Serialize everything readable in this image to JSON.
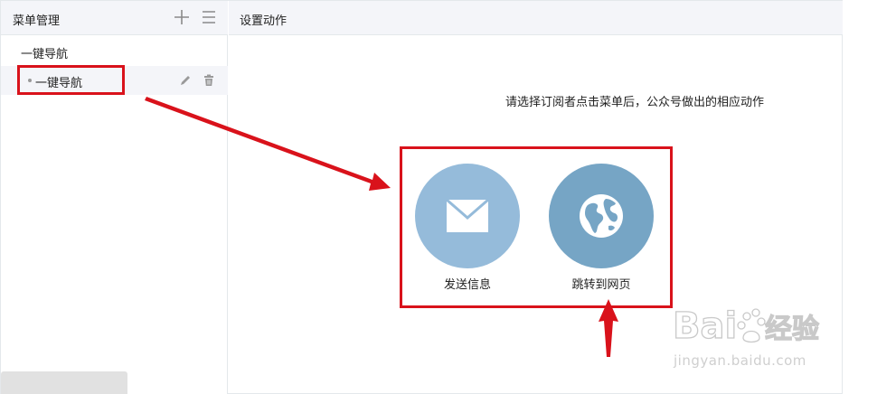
{
  "left_panel": {
    "title": "菜单管理",
    "add_icon": "plus-icon",
    "list_icon": "hamburger-icon",
    "items": [
      {
        "label": "一键导航",
        "level": 1
      },
      {
        "label": "一键导航",
        "level": 2,
        "selected": true,
        "actions": [
          "edit-icon",
          "delete-icon"
        ]
      }
    ]
  },
  "right_panel": {
    "title": "设置动作",
    "instruction": "请选择订阅者点击菜单后，公众号做出的相应动作",
    "options": [
      {
        "label": "发送信息",
        "icon": "envelope-icon",
        "color": "#95bbda"
      },
      {
        "label": "跳转到网页",
        "icon": "globe-icon",
        "color": "#76a5c5"
      }
    ]
  },
  "annotations": {
    "highlight_color": "#d9121b"
  },
  "watermark": {
    "logo_text": "Baidu经验",
    "url": "jingyan.baidu.com"
  }
}
